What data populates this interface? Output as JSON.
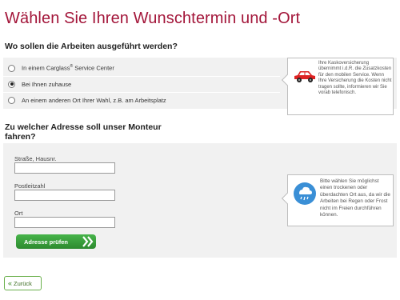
{
  "title": "Wählen Sie Ihren Wunschtermin und -Ort",
  "location_section": {
    "heading": "Wo sollen die Arbeiten ausgeführt werden?",
    "options": [
      {
        "label": "In einem Carglass",
        "sup": "®",
        "label_suffix": " Service Center",
        "selected": false
      },
      {
        "label": "Bei Ihnen zuhause",
        "selected": true
      },
      {
        "label": "An einem anderen Ort Ihrer Wahl, z.B. am Arbeitsplatz",
        "selected": false
      }
    ],
    "info": {
      "icon": "red-car-icon",
      "text": "Ihre Kaskoversicherung übernimmt i.d.R. die Zusatzkosten für den mobilen Service. Wenn Ihre Versicherung die Kosten nicht tragen sollte, informieren wir Sie vorab telefonisch."
    }
  },
  "address_section": {
    "heading": "Zu welcher Adresse soll unser Monteur fahren?",
    "fields": [
      {
        "label": "Straße, Hausnr.",
        "value": ""
      },
      {
        "label": "Postleitzahl",
        "value": ""
      },
      {
        "label": "Ort",
        "value": ""
      }
    ],
    "check_button": "Adresse prüfen",
    "info": {
      "icon": "rain-cloud-icon",
      "text": "Bitte wählen Sie möglichst einen trockenen oder überdachten Ort aus, da wir die Arbeiten bei Regen oder Frost nicht im Freien durchführen können."
    }
  },
  "back_button": {
    "icon": "«",
    "label": "Zurück"
  },
  "colors": {
    "title": "#a3163a",
    "panel": "#f1f1f1",
    "button_green": "#3a9e3c",
    "car_red": "#d22"
  }
}
